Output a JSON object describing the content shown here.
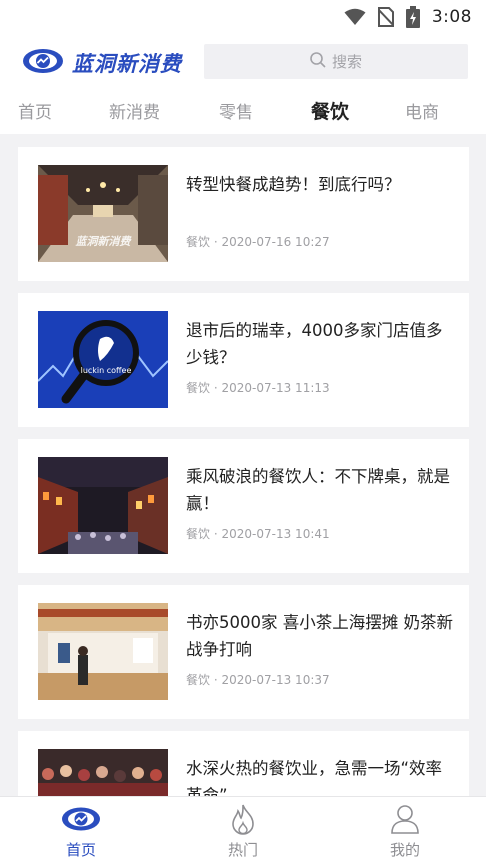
{
  "status_bar": {
    "time": "3:08",
    "icons": [
      "wifi-icon",
      "no-sim-icon",
      "battery-charging-icon"
    ]
  },
  "header": {
    "logo_text": "蓝洞新消费",
    "search_placeholder": "搜索"
  },
  "tabs": [
    {
      "label": "首页",
      "active": false
    },
    {
      "label": "新消费",
      "active": false
    },
    {
      "label": "零售",
      "active": false
    },
    {
      "label": "餐饮",
      "active": true
    },
    {
      "label": "电商",
      "active": false
    }
  ],
  "articles": [
    {
      "title": "转型快餐成趋势！到底行吗？",
      "category": "餐饮",
      "separator": "·",
      "datetime": "2020-07-16 10:27",
      "thumb_watermark": "蓝洞新消费"
    },
    {
      "title": "退市后的瑞幸，4000多家门店值多少钱？",
      "category": "餐饮",
      "separator": "·",
      "datetime": "2020-07-13 11:13",
      "thumb_text": "luckin coffee"
    },
    {
      "title": "乘风破浪的餐饮人：不下牌桌，就是赢！",
      "category": "餐饮",
      "separator": "·",
      "datetime": "2020-07-13 10:41"
    },
    {
      "title": "书亦5000家 喜小茶上海摆摊 奶茶新战争打响",
      "category": "餐饮",
      "separator": "·",
      "datetime": "2020-07-13 10:37"
    },
    {
      "title": "水深火热的餐饮业，急需一场“效率革命”",
      "category": "",
      "separator": "",
      "datetime": ""
    }
  ],
  "bottom_nav": [
    {
      "label": "首页",
      "icon": "eye-logo-icon",
      "active": true
    },
    {
      "label": "热门",
      "icon": "flame-icon",
      "active": false
    },
    {
      "label": "我的",
      "icon": "user-icon",
      "active": false
    }
  ],
  "colors": {
    "brand": "#2a4dbf",
    "background": "#f2f2f4",
    "meta_text": "#a0a0a4",
    "inactive_tab": "#9a9a9e"
  }
}
